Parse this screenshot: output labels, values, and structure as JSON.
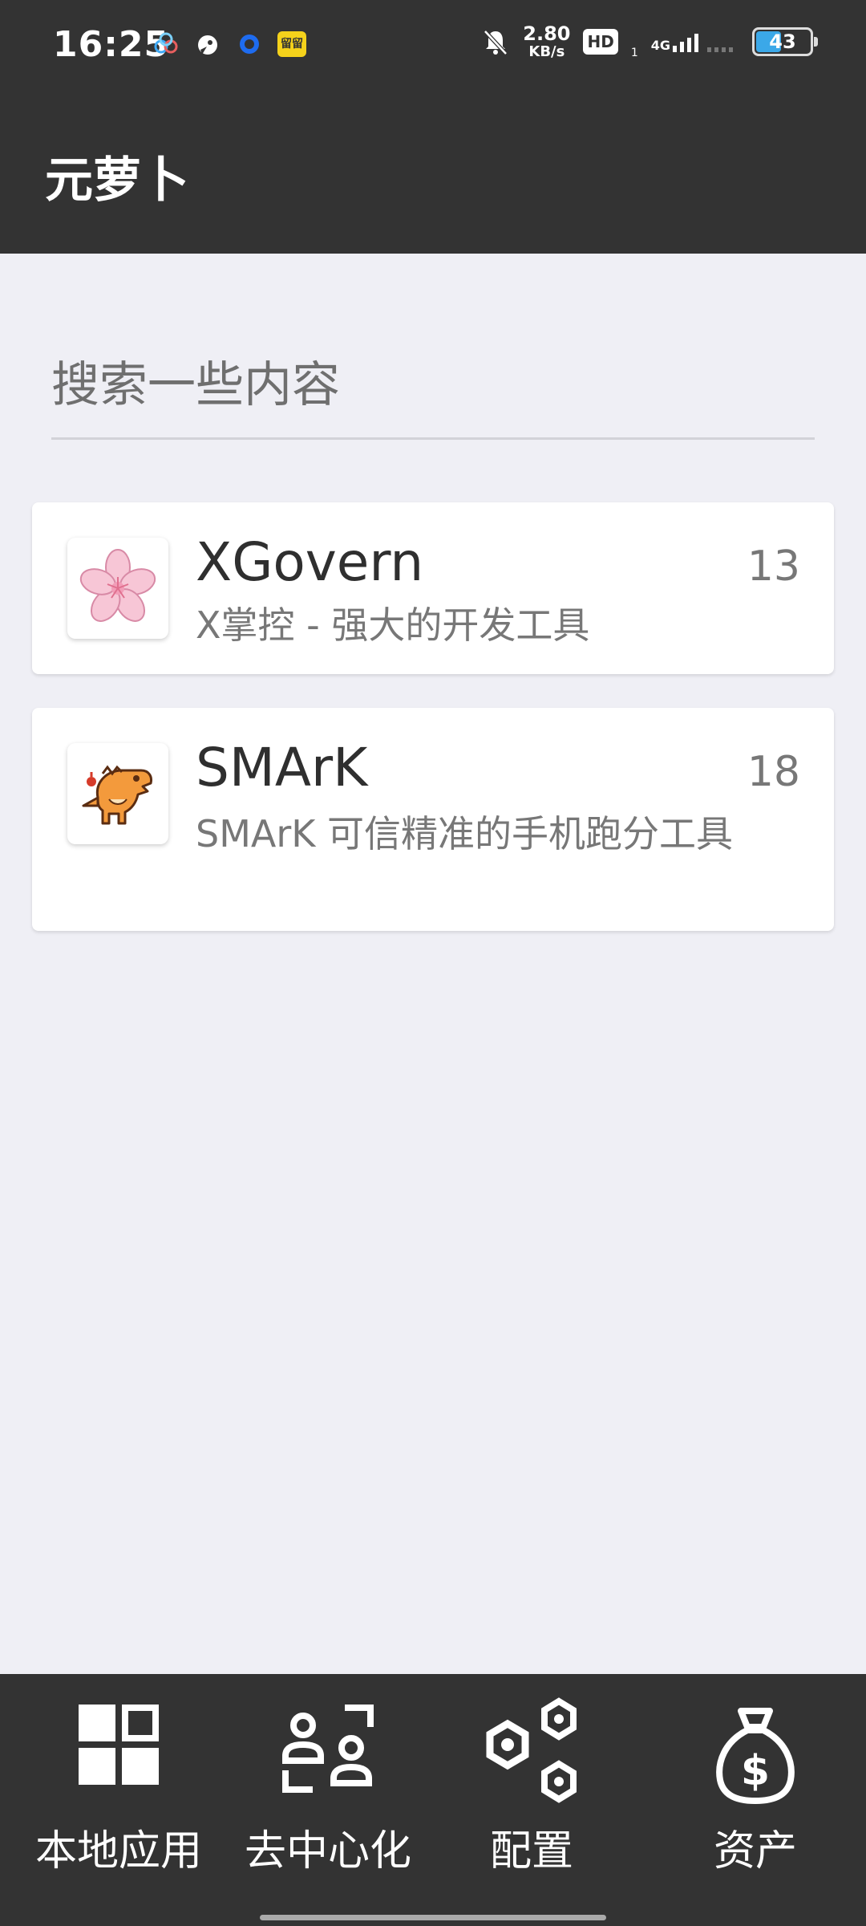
{
  "status_bar": {
    "time": "16:25",
    "speed_value": "2.80",
    "speed_unit": "KB/s",
    "hd_label": "HD",
    "sim_index": "1",
    "network": "4G",
    "battery_level": "43",
    "badge_text": "留留"
  },
  "app_bar": {
    "title": "元萝卜"
  },
  "search": {
    "placeholder": "搜索一些内容"
  },
  "apps": [
    {
      "name": "XGovern",
      "description": "X掌控 - 强大的开发工具",
      "count": "13",
      "icon": "sakura-flower-icon"
    },
    {
      "name": "SMArK",
      "description": "SMArK 可信精准的手机跑分工具",
      "count": "18",
      "icon": "dinosaur-icon"
    }
  ],
  "bottom_nav": [
    {
      "label": "本地应用",
      "icon": "grid-apps-icon"
    },
    {
      "label": "去中心化",
      "icon": "decentralized-users-icon"
    },
    {
      "label": "配置",
      "icon": "hexagon-settings-icon"
    },
    {
      "label": "资产",
      "icon": "money-bag-icon"
    }
  ],
  "colors": {
    "bar_background": "#333333",
    "page_background": "#efeff5",
    "battery_fill": "#3ba8e8"
  }
}
